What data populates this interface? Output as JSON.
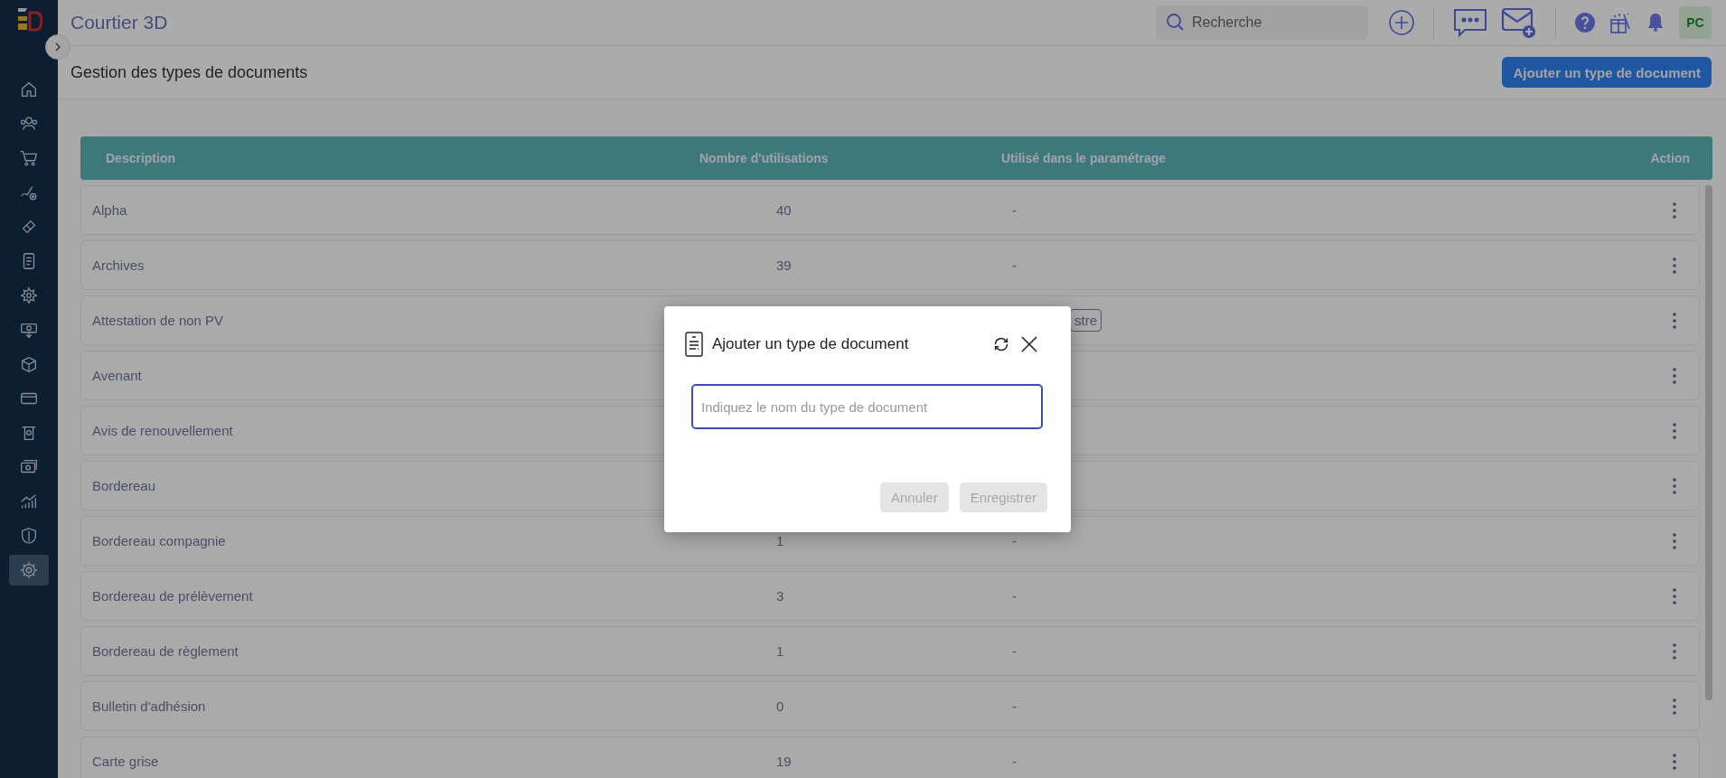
{
  "app": {
    "title": "Courtier 3D"
  },
  "sidebar": {
    "items": [
      {
        "selected": false
      },
      {
        "selected": false
      },
      {
        "selected": false
      },
      {
        "selected": false
      },
      {
        "selected": false
      },
      {
        "selected": false
      },
      {
        "selected": false
      },
      {
        "selected": false
      },
      {
        "selected": false
      },
      {
        "selected": false
      },
      {
        "selected": false
      },
      {
        "selected": false
      },
      {
        "selected": false
      },
      {
        "selected": false
      },
      {
        "selected": true
      }
    ]
  },
  "topbar": {
    "search": {
      "placeholder": "Recherche"
    },
    "avatar": "PC"
  },
  "page": {
    "title": "Gestion des types de documents",
    "add_button": "Ajouter un type de document"
  },
  "table": {
    "columns": [
      "Description",
      "Nombre d'utilisations",
      "Utilisé dans le paramétrage",
      "Action"
    ],
    "rows": [
      {
        "description": "Alpha",
        "count": "40",
        "usage": "-"
      },
      {
        "description": "Archives",
        "count": "39",
        "usage": "-"
      },
      {
        "description": "Attestation de non PV",
        "usage_tag": "stre"
      },
      {
        "description": "Avenant"
      },
      {
        "description": "Avis de renouvellement"
      },
      {
        "description": "Bordereau"
      },
      {
        "description": "Bordereau compagnie",
        "count": "1",
        "usage": "-"
      },
      {
        "description": "Bordereau de prélèvement",
        "count": "3",
        "usage": "-"
      },
      {
        "description": "Bordereau de règlement",
        "count": "1",
        "usage": "-"
      },
      {
        "description": "Bulletin d'adhésion",
        "count": "0",
        "usage": "-"
      },
      {
        "description": "Carte grise",
        "count": "19",
        "usage": "-"
      }
    ]
  },
  "dialog": {
    "title": "Ajouter un type de document",
    "input": {
      "placeholder": "Indiquez le nom du type de document"
    },
    "buttons": [
      {
        "label": "Annuler",
        "disabled": true
      },
      {
        "label": "Enregistrer",
        "disabled": true
      }
    ]
  }
}
